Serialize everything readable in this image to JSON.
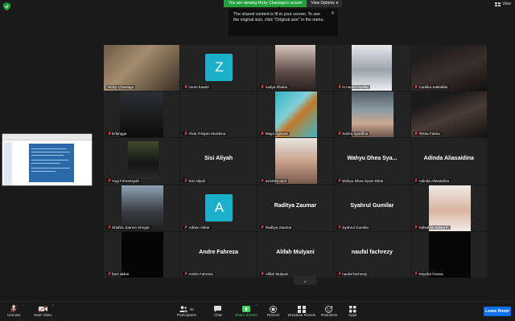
{
  "banner": {
    "viewing": "You are viewing Rizky Chaniago's screen",
    "options": "View Options"
  },
  "view_label": "View",
  "tooltip": {
    "text": "The shared content is fit to your screen. To see the original size, click \"Original size\" in the menu."
  },
  "participants": [
    {
      "name": "Rizky Chaniago",
      "muted": false,
      "type": "video",
      "active": true
    },
    {
      "name": "zoom baa04",
      "muted": true,
      "type": "avatar",
      "letter": "Z"
    },
    {
      "name": "nadya khairia",
      "muted": true,
      "type": "video"
    },
    {
      "name": "m naufal musfiq",
      "muted": true,
      "type": "video"
    },
    {
      "name": "Cantika Salsabila",
      "muted": true,
      "type": "video"
    },
    {
      "name": "Erlangga",
      "muted": true,
      "type": "video"
    },
    {
      "name": "Alvia Fridyan Murdena",
      "muted": true,
      "type": "blank"
    },
    {
      "name": "Maya Agrianti",
      "muted": true,
      "type": "video"
    },
    {
      "name": "Salma Syarifina",
      "muted": true,
      "type": "video"
    },
    {
      "name": "Tessa Fatma",
      "muted": true,
      "type": "video"
    },
    {
      "name": "Yogi Firmansyah",
      "muted": true,
      "type": "video"
    },
    {
      "name": "Sisi Aliyah",
      "muted": true,
      "type": "text",
      "big": "Sisi Aliyah"
    },
    {
      "name": "azzahra tarin",
      "muted": true,
      "type": "video"
    },
    {
      "name": "Wahyu Dhea Syam Dikta",
      "muted": true,
      "type": "text",
      "big": "Wahyu  Dhea  Sya..."
    },
    {
      "name": "Adinda Aliasaidina",
      "muted": true,
      "type": "text",
      "big": "Adinda Aliasaidina"
    },
    {
      "name": "Shafira Joanne Siregar",
      "muted": true,
      "type": "video"
    },
    {
      "name": "Adrian Akbar",
      "muted": true,
      "type": "avatar",
      "letter": "A"
    },
    {
      "name": "Raditya Zaumar",
      "muted": true,
      "type": "text",
      "big": "Raditya Zaumar"
    },
    {
      "name": "Syahrul Gumilar",
      "muted": true,
      "type": "text",
      "big": "Syahrul Gumilar"
    },
    {
      "name": "Salsabila Salwa F.",
      "muted": true,
      "type": "video"
    },
    {
      "name": "fazri akbar",
      "muted": true,
      "type": "video"
    },
    {
      "name": "Andre Fahreza",
      "muted": true,
      "type": "text",
      "big": "Andre Fahreza"
    },
    {
      "name": "Alifah Mulyani",
      "muted": true,
      "type": "text",
      "big": "Alifah Mulyani"
    },
    {
      "name": "naufal fachrezy",
      "muted": true,
      "type": "text",
      "big": "naufal fachrezy"
    },
    {
      "name": "Keysha Ovana",
      "muted": true,
      "type": "video"
    }
  ],
  "toolbar": {
    "unmute": "Unmute",
    "start_video": "Start Video",
    "participants": "Participants",
    "participants_count": "40",
    "chat": "Chat",
    "share_screen": "Share Screen",
    "record": "Record",
    "breakout_rooms": "Breakout Rooms",
    "reactions": "Reactions",
    "apps": "Apps",
    "leave": "Leave Room"
  },
  "colors": {
    "accent_green": "#23a03c",
    "leave_blue": "#0e72ed",
    "avatar_teal": "#1bb0c9",
    "active_speaker": "#e6e03a"
  }
}
